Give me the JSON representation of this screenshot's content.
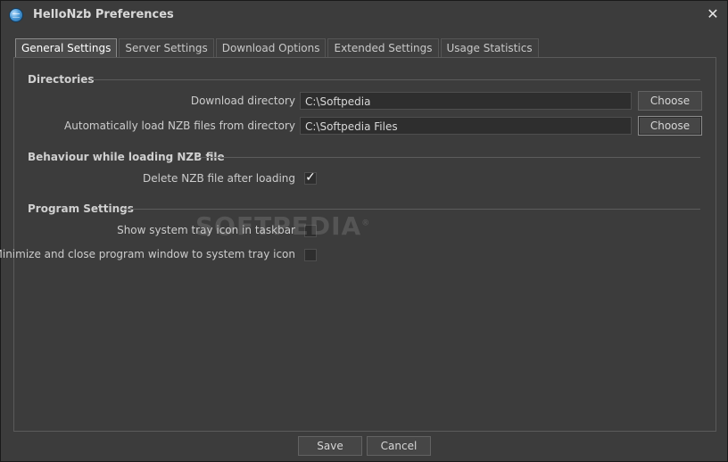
{
  "window": {
    "title": "HelloNzb Preferences",
    "close_glyph": "✕"
  },
  "tabs": [
    {
      "label": "General Settings",
      "active": true
    },
    {
      "label": "Server Settings",
      "active": false
    },
    {
      "label": "Download Options",
      "active": false
    },
    {
      "label": "Extended Settings",
      "active": false
    },
    {
      "label": "Usage Statistics",
      "active": false
    }
  ],
  "sections": {
    "directories": {
      "title": "Directories",
      "download_dir_label": "Download directory",
      "download_dir_value": "C:\\Softpedia",
      "auto_load_label": "Automatically load NZB files from directory",
      "auto_load_value": "C:\\Softpedia Files",
      "choose_label": "Choose"
    },
    "behaviour": {
      "title": "Behaviour while loading NZB file",
      "delete_label": "Delete NZB file after loading",
      "delete_checked": true,
      "check_glyph": "✓"
    },
    "program": {
      "title": "Program Settings",
      "tray_icon_label": "Show system tray icon in taskbar",
      "tray_icon_checked": false,
      "minimize_label": "Minimize and close program window to system tray icon",
      "minimize_checked": false
    }
  },
  "footer": {
    "save_label": "Save",
    "cancel_label": "Cancel"
  },
  "watermark": {
    "text": "SOFTPEDIA",
    "mark": "®"
  },
  "icons": {
    "app": "globe-icon",
    "close": "close-icon",
    "check": "checkmark-icon"
  },
  "colors": {
    "background": "#3c3c3c",
    "field": "#2e2e2e",
    "text": "#cccccc"
  }
}
